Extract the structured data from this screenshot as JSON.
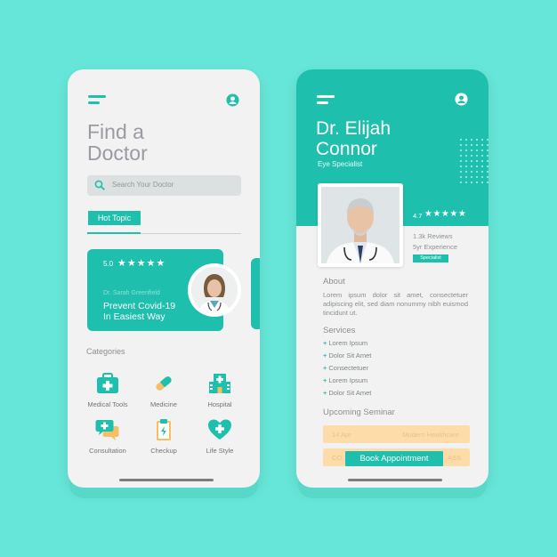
{
  "colors": {
    "background": "#66e6d8",
    "accent": "#1fbfae",
    "seminar": "#fddcaa"
  },
  "left": {
    "title_line1": "Find a",
    "title_line2": "Doctor",
    "search_placeholder": "Search Your Doctor",
    "hot_topic": "Hot Topic",
    "card": {
      "rating": "5.0",
      "stars": "★★★★★",
      "doctor": "Dr. Sarah Greenfield",
      "line1": "Prevent Covid-19",
      "line2": "In Easiest Way"
    },
    "categories_title": "Categories",
    "categories": [
      {
        "label": "Medical Tools",
        "icon": "medical-kit-icon"
      },
      {
        "label": "Medicine",
        "icon": "pill-icon"
      },
      {
        "label": "Hospital",
        "icon": "hospital-icon"
      },
      {
        "label": "Consultation",
        "icon": "chat-bubbles-icon"
      },
      {
        "label": "Checkup",
        "icon": "clipboard-icon"
      },
      {
        "label": "Life Style",
        "icon": "heart-plus-icon"
      }
    ]
  },
  "right": {
    "name_line1": "Dr. Elijah",
    "name_line2": "Connor",
    "specialty": "Eye Specialist",
    "rating": "4.7",
    "stars": "★★★★★",
    "reviews": "1.3k Reviews",
    "experience": "5yr Experience",
    "badge": "Specialist",
    "about_title": "About",
    "about_text": "Lorem ipsum dolor sit amet, consectetuer adipiscing elit, sed diam nonummy nibh euismod tincidunt ut.",
    "services_title": "Services",
    "services": [
      "Lorem Ipsum",
      "Dolor Sit Amet",
      "Consectetuer",
      "Lorem Ipsum",
      "Dolor Sit Amet"
    ],
    "seminar_title": "Upcoming Seminar",
    "seminar1_date": "14 Apr",
    "seminar1_name": "Modern Healthcare",
    "seminar2_date": "CO",
    "seminar2_name": "ASS",
    "book_button": "Book Appointment"
  }
}
